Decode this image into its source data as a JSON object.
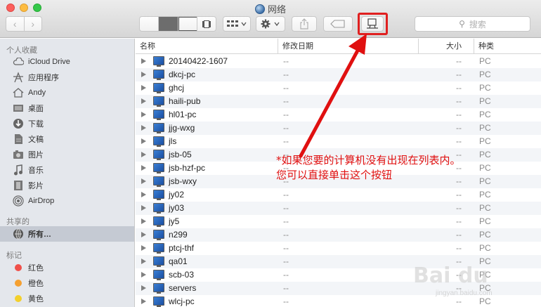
{
  "window": {
    "title": "网络"
  },
  "toolbar": {
    "back_icon": "chevron-left-icon",
    "forward_icon": "chevron-right-icon",
    "views": [
      "icon-view",
      "list-view",
      "column-view",
      "coverflow-view"
    ],
    "active_view": "list-view",
    "search_placeholder": "搜索",
    "highlight_color": "#e02020"
  },
  "sidebar": {
    "favorites_title": "个人收藏",
    "favorites": [
      {
        "label": "iCloud Drive",
        "icon": "cloud-icon"
      },
      {
        "label": "应用程序",
        "icon": "applications-icon"
      },
      {
        "label": "Andy",
        "icon": "home-icon"
      },
      {
        "label": "桌面",
        "icon": "desktop-icon"
      },
      {
        "label": "下载",
        "icon": "download-icon"
      },
      {
        "label": "文稿",
        "icon": "documents-icon"
      },
      {
        "label": "图片",
        "icon": "pictures-icon"
      },
      {
        "label": "音乐",
        "icon": "music-icon"
      },
      {
        "label": "影片",
        "icon": "movies-icon"
      },
      {
        "label": "AirDrop",
        "icon": "airdrop-icon"
      }
    ],
    "shared_title": "共享的",
    "shared": [
      {
        "label": "所有…",
        "icon": "network-icon",
        "selected": true
      }
    ],
    "tags_title": "标记",
    "tags": [
      {
        "label": "红色",
        "color": "#f0504a"
      },
      {
        "label": "橙色",
        "color": "#f5a030"
      },
      {
        "label": "黄色",
        "color": "#f3d02c"
      }
    ]
  },
  "list": {
    "headers": {
      "name": "名称",
      "date": "修改日期",
      "size": "大小",
      "kind": "种类"
    },
    "rows": [
      {
        "name": "20140422-1607",
        "date": "--",
        "size": "--",
        "kind": "PC"
      },
      {
        "name": "dkcj-pc",
        "date": "--",
        "size": "--",
        "kind": "PC"
      },
      {
        "name": "ghcj",
        "date": "--",
        "size": "--",
        "kind": "PC"
      },
      {
        "name": "haili-pub",
        "date": "--",
        "size": "--",
        "kind": "PC"
      },
      {
        "name": "hl01-pc",
        "date": "--",
        "size": "--",
        "kind": "PC"
      },
      {
        "name": "jjg-wxg",
        "date": "--",
        "size": "--",
        "kind": "PC"
      },
      {
        "name": "jls",
        "date": "--",
        "size": "--",
        "kind": "PC"
      },
      {
        "name": "jsb-05",
        "date": "--",
        "size": "--",
        "kind": "PC"
      },
      {
        "name": "jsb-hzf-pc",
        "date": "--",
        "size": "--",
        "kind": "PC"
      },
      {
        "name": "jsb-wxy",
        "date": "--",
        "size": "--",
        "kind": "PC"
      },
      {
        "name": "jy02",
        "date": "--",
        "size": "--",
        "kind": "PC"
      },
      {
        "name": "jy03",
        "date": "--",
        "size": "--",
        "kind": "PC"
      },
      {
        "name": "jy5",
        "date": "--",
        "size": "--",
        "kind": "PC"
      },
      {
        "name": "n299",
        "date": "--",
        "size": "--",
        "kind": "PC"
      },
      {
        "name": "ptcj-thf",
        "date": "--",
        "size": "--",
        "kind": "PC"
      },
      {
        "name": "qa01",
        "date": "--",
        "size": "--",
        "kind": "PC"
      },
      {
        "name": "scb-03",
        "date": "--",
        "size": "--",
        "kind": "PC"
      },
      {
        "name": "servers",
        "date": "--",
        "size": "--",
        "kind": "PC"
      },
      {
        "name": "wlcj-pc",
        "date": "--",
        "size": "--",
        "kind": "PC"
      }
    ]
  },
  "annotation": {
    "line1": "*如果您要的计算机没有出现在列表内。",
    "line2": "您可以直接单击这个按钮",
    "color": "#e01010"
  },
  "watermark": {
    "text": "Bai du",
    "sub": "jingyan.baidu.com"
  }
}
